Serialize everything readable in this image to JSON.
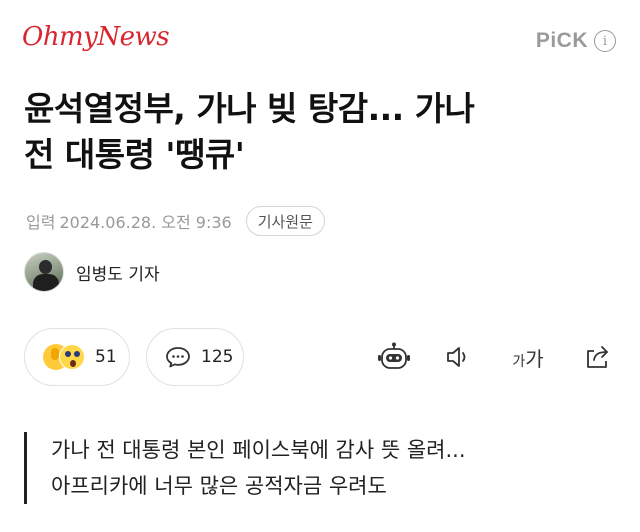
{
  "header": {
    "logo_text": "OhmyNews",
    "logo_color": "#d7262f",
    "pick_label": "PiCK",
    "info_icon": "i"
  },
  "article": {
    "title_line1": "윤석열정부, 가나 빚 탕감... 가나",
    "title_line2": "전 대통령 '땡큐'",
    "meta_label": "입력",
    "date": "2024.06.28. 오전 9:36",
    "original_button": "기사원문"
  },
  "reporter": {
    "name": "임병도 기자"
  },
  "actions": {
    "reaction_count": "51",
    "comment_count": "125",
    "font_small": "가",
    "font_large": "가"
  },
  "summary": {
    "line1": "가나 전 대통령 본인 페이스북에 감사 뜻 올려...",
    "line2": "아프리카에 너무 많은 공적자금 우려도"
  },
  "icons": [
    "info-icon",
    "thumbs-up-emoji-icon",
    "surprised-emoji-icon",
    "comment-icon",
    "robot-summary-icon",
    "speaker-icon",
    "font-size-icon",
    "share-icon"
  ]
}
